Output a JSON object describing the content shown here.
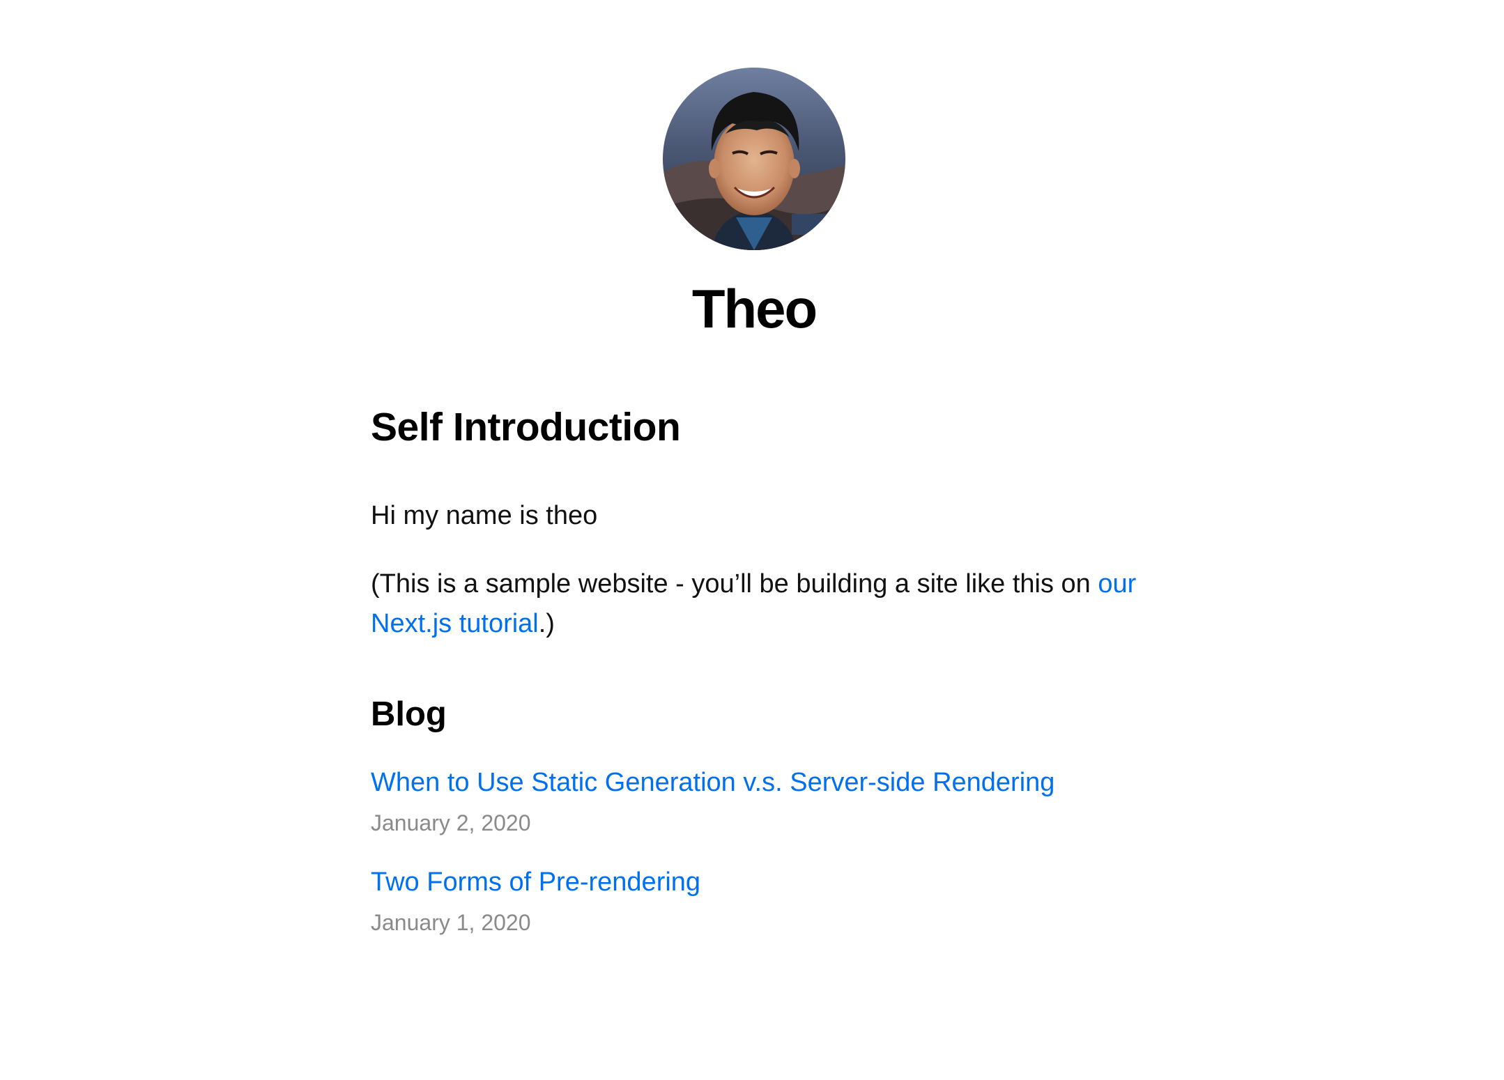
{
  "site": {
    "name": "Theo",
    "avatar_alt": "Theo"
  },
  "intro": {
    "heading": "Self Introduction",
    "greeting": "Hi my name is theo",
    "note_prefix": "(This is a sample website - you’ll be building a site like this on ",
    "note_link": "our Next.js tutorial",
    "note_suffix": ".)"
  },
  "blog": {
    "heading": "Blog",
    "posts": [
      {
        "title": "When to Use Static Generation v.s. Server-side Rendering",
        "date": "January 2, 2020"
      },
      {
        "title": "Two Forms of Pre-rendering",
        "date": "January 1, 2020"
      }
    ]
  },
  "colors": {
    "link": "#0070f3",
    "date": "#8a8a8a",
    "text": "#111111"
  }
}
